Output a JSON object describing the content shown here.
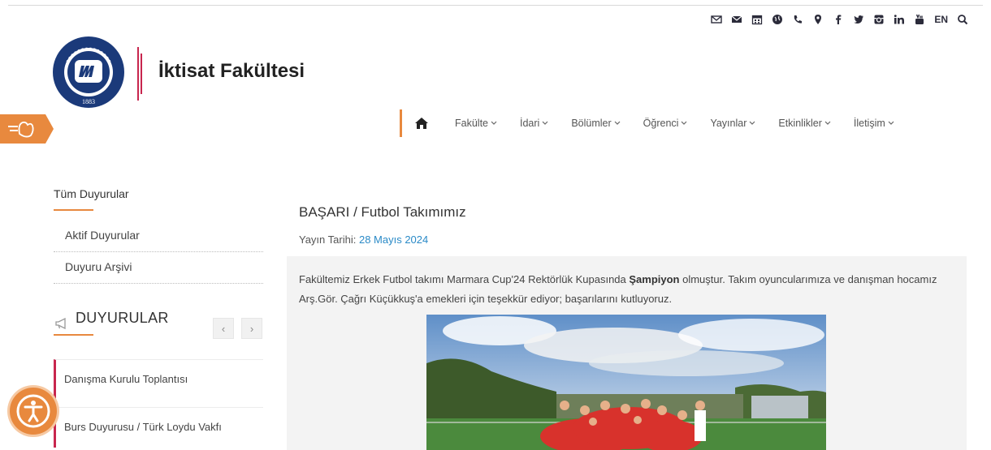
{
  "header": {
    "title": "İktisat Fakültesi",
    "topbar_icons": [
      "envelope-outline-icon",
      "envelope-icon",
      "calendar-icon",
      "globe-icon",
      "phone-icon",
      "map-marker-icon",
      "facebook-icon",
      "twitter-icon",
      "instagram-icon",
      "linkedin-icon",
      "youtube-icon"
    ],
    "lang_label": "EN",
    "logo_text": "1883",
    "colors": {
      "accent": "#e8893e",
      "brand": "#1b3a7a",
      "red": "#c8264e"
    }
  },
  "nav": {
    "items": [
      {
        "label": "Fakülte"
      },
      {
        "label": "İdari"
      },
      {
        "label": "Bölümler"
      },
      {
        "label": "Öğrenci"
      },
      {
        "label": "Yayınlar"
      },
      {
        "label": "Etkinlikler"
      },
      {
        "label": "İletişim"
      }
    ]
  },
  "sidebar": {
    "title": "Tüm Duyurular",
    "links": [
      {
        "label": "Aktif Duyurular"
      },
      {
        "label": "Duyuru Arşivi"
      }
    ],
    "announcements_title": "DUYURULAR",
    "prev_label": "‹",
    "next_label": "›",
    "announcements": [
      {
        "label": "Danışma Kurulu Toplantısı"
      },
      {
        "label": "Burs Duyurusu / Türk Loydu Vakfı"
      }
    ]
  },
  "post": {
    "title": "BAŞARI / Futbol Takımımız",
    "meta_label": "Yayın Tarihi:",
    "date": "28 Mayıs 2024",
    "text_1": "Fakültemiz Erkek Futbol takımı Marmara Cup'24 Rektörlük Kupasında ",
    "text_bold": "Şampiyon",
    "text_2": " olmuştur. Takım oyuncularımıza ve danışman hocamız Arş.Gör. Çağrı Küçükkuş'a emekleri için teşekkür ediyor; başarılarını kutluyoruz."
  }
}
